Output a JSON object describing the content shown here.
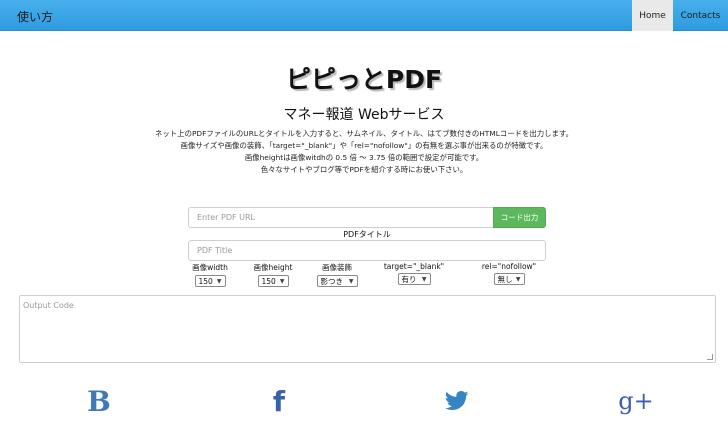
{
  "nav": {
    "brand": "使い方",
    "home": "Home",
    "contacts": "Contacts"
  },
  "hero": {
    "title": "ピピっとPDF",
    "subtitle": "マネー報道 Webサービス",
    "desc": [
      "ネット上のPDFファイルのURLとタイトルを入力すると、サムネイル、タイトル、はてブ数付きのHTMLコードを出力します。",
      "画像サイズや画像の装飾、「target=\"_blank\"」や「rel=\"nofollow\"」の有無を選ぶ事が出来るのが特徴です。",
      "画像heightは画像witdhの 0.5 倍 ～ 3.75 倍の範囲で設定が可能です。",
      "色々なサイトやブログ等でPDFを紹介する時にお使い下さい。"
    ]
  },
  "form": {
    "url_placeholder": "Enter PDF URL",
    "generate_label": "コード出力",
    "pdf_title_label": "PDFタイトル",
    "title_placeholder": "PDF Title",
    "options": [
      {
        "label": "画像width",
        "value": "150"
      },
      {
        "label": "画像height",
        "value": "150"
      },
      {
        "label": "画像装飾",
        "value": "影つき"
      },
      {
        "label": "target=\"_blank\"",
        "value": "有り"
      },
      {
        "label": "rel=\"nofollow\"",
        "value": "無し"
      }
    ],
    "output_placeholder": "Output Code"
  },
  "share": {
    "hatena_glyph": "B",
    "facebook_glyph": "f",
    "googleplus_glyph": "g+",
    "icons": [
      "hatena-bookmark-icon",
      "facebook-icon",
      "twitter-icon",
      "google-plus-icon"
    ],
    "colors": {
      "hatena": "#3f79b7",
      "facebook": "#3a62a8",
      "twitter": "#3584c4",
      "googleplus": "#3d5db3"
    }
  },
  "theme": {
    "navbar": "#3aa6e8",
    "nav_active_bg": "#e9e9e9",
    "button_green": "#5cb85c"
  }
}
